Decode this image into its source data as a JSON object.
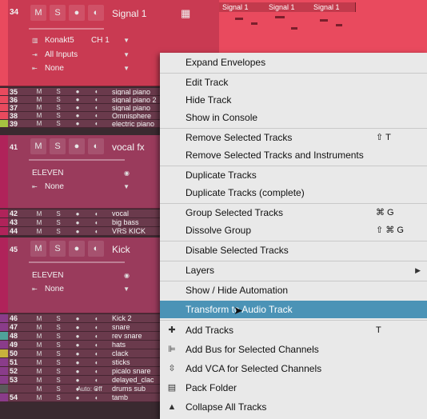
{
  "tracks": {
    "t34": {
      "num": "34",
      "m": "M",
      "s": "S",
      "name": "Signal 1",
      "instrument": "Konakt5",
      "channel": "CH 1",
      "input": "All Inputs",
      "output": "None"
    },
    "small1": [
      {
        "num": "35",
        "name": "signal piano",
        "color": "#e94a5e"
      },
      {
        "num": "36",
        "name": "signal piano 2",
        "color": "#e94a5e"
      },
      {
        "num": "37",
        "name": "signal piano",
        "color": "#e94a5e"
      },
      {
        "num": "38",
        "name": "Omnisphere",
        "color": "#e94a5e"
      },
      {
        "num": "39",
        "name": "electric piano",
        "color": "#a5c241"
      }
    ],
    "t41": {
      "num": "41",
      "m": "M",
      "s": "S",
      "name": "vocal fx",
      "preset": "ELEVEN",
      "output": "None"
    },
    "small2": [
      {
        "num": "42",
        "name": "vocal",
        "color": "#b0235a"
      },
      {
        "num": "43",
        "name": "big bass",
        "color": "#b0235a"
      },
      {
        "num": "44",
        "name": "VRS KICK",
        "color": "#b0235a"
      }
    ],
    "t45": {
      "num": "45",
      "m": "M",
      "s": "S",
      "name": "Kick",
      "preset": "ELEVEN",
      "output": "None"
    },
    "small3": [
      {
        "num": "46",
        "name": "Kick 2",
        "color": "#8a3c8a"
      },
      {
        "num": "47",
        "name": "snare",
        "color": "#8a3c8a"
      },
      {
        "num": "48",
        "name": "rev snare",
        "color": "#4fa29a"
      },
      {
        "num": "49",
        "name": "hats",
        "color": "#8a3c8a"
      },
      {
        "num": "50",
        "name": "clack",
        "color": "#c8b13c"
      },
      {
        "num": "51",
        "name": "sticks",
        "color": "#8a3c8a"
      },
      {
        "num": "52",
        "name": "picalo snare",
        "color": "#8a3c8a"
      },
      {
        "num": "53",
        "name": "delayed_clac",
        "color": "#8a3c8a"
      },
      {
        "num": "",
        "name": "drums sub",
        "color": "#5a5a5a",
        "auto": "Auto: Off"
      },
      {
        "num": "54",
        "name": "tamb",
        "color": "#8a3c8a"
      }
    ]
  },
  "timeline": {
    "clips": [
      "Signal 1",
      "Signal 1",
      "Signal 1"
    ]
  },
  "menu": {
    "expand_envelopes": "Expand Envelopes",
    "edit_track": "Edit Track",
    "hide_track": "Hide Track",
    "show_in_console": "Show in Console",
    "remove_selected_tracks": "Remove Selected Tracks",
    "remove_selected_tracks_sc": "⇧ T",
    "remove_tracks_instruments": "Remove Selected Tracks and Instruments",
    "duplicate_tracks": "Duplicate Tracks",
    "duplicate_tracks_complete": "Duplicate Tracks (complete)",
    "group_selected": "Group Selected Tracks",
    "group_selected_sc": "⌘ G",
    "dissolve_group": "Dissolve Group",
    "dissolve_group_sc": "⇧ ⌘ G",
    "disable_selected": "Disable Selected Tracks",
    "layers": "Layers",
    "show_hide_automation": "Show / Hide Automation",
    "transform_audio": "Transform to Audio Track",
    "add_tracks": "Add Tracks",
    "add_tracks_sc": "T",
    "add_bus": "Add Bus for Selected Channels",
    "add_vca": "Add VCA for Selected Channels",
    "pack_folder": "Pack Folder",
    "collapse_all": "Collapse All Tracks"
  },
  "colors": {
    "highlight": "#4b93b6",
    "track_red": "#e94a5e",
    "menu_bg": "#e9e9e9"
  }
}
